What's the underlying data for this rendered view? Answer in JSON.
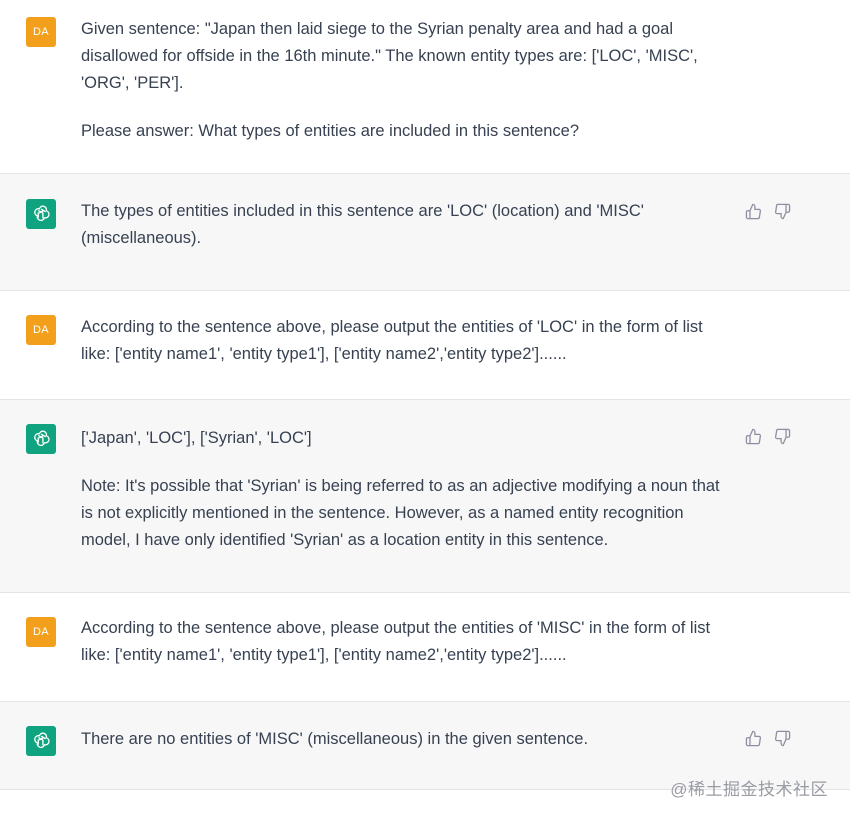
{
  "user_initials": "DA",
  "messages": [
    {
      "role": "user",
      "paragraphs": [
        "Given sentence: \"Japan then laid siege to the Syrian penalty area and had a goal disallowed for offside in the 16th minute.\" The known entity types are: ['LOC', 'MISC', 'ORG', 'PER'].",
        "Please answer: What types of entities are included in this sentence?"
      ]
    },
    {
      "role": "assistant",
      "paragraphs": [
        "The types of entities included in this sentence are 'LOC' (location) and 'MISC' (miscellaneous)."
      ]
    },
    {
      "role": "user",
      "paragraphs": [
        "According to the sentence above, please output the entities of 'LOC' in the form of list like: ['entity name1', 'entity type1'], ['entity name2','entity type2']......"
      ]
    },
    {
      "role": "assistant",
      "paragraphs": [
        "['Japan', 'LOC'], ['Syrian', 'LOC']",
        "Note: It's possible that 'Syrian' is being referred to as an adjective modifying a noun that is not explicitly mentioned in the sentence. However, as a named entity recognition model, I have only identified 'Syrian' as a location entity in this sentence."
      ]
    },
    {
      "role": "user",
      "paragraphs": [
        "According to the sentence above, please output the entities of 'MISC' in the form of list like: ['entity name1', 'entity type1'], ['entity name2','entity type2']......"
      ]
    },
    {
      "role": "assistant",
      "paragraphs": [
        "There are no entities of 'MISC' (miscellaneous) in the given sentence."
      ]
    }
  ],
  "icons": {
    "thumbs_up": "thumbs-up-icon",
    "thumbs_down": "thumbs-down-icon",
    "bot_avatar": "openai-logo-icon"
  },
  "colors": {
    "user_avatar_bg": "#f29f1c",
    "bot_avatar_bg": "#10a37f",
    "assistant_row_bg": "#f7f7f8"
  },
  "watermark": "@稀土掘金技术社区"
}
